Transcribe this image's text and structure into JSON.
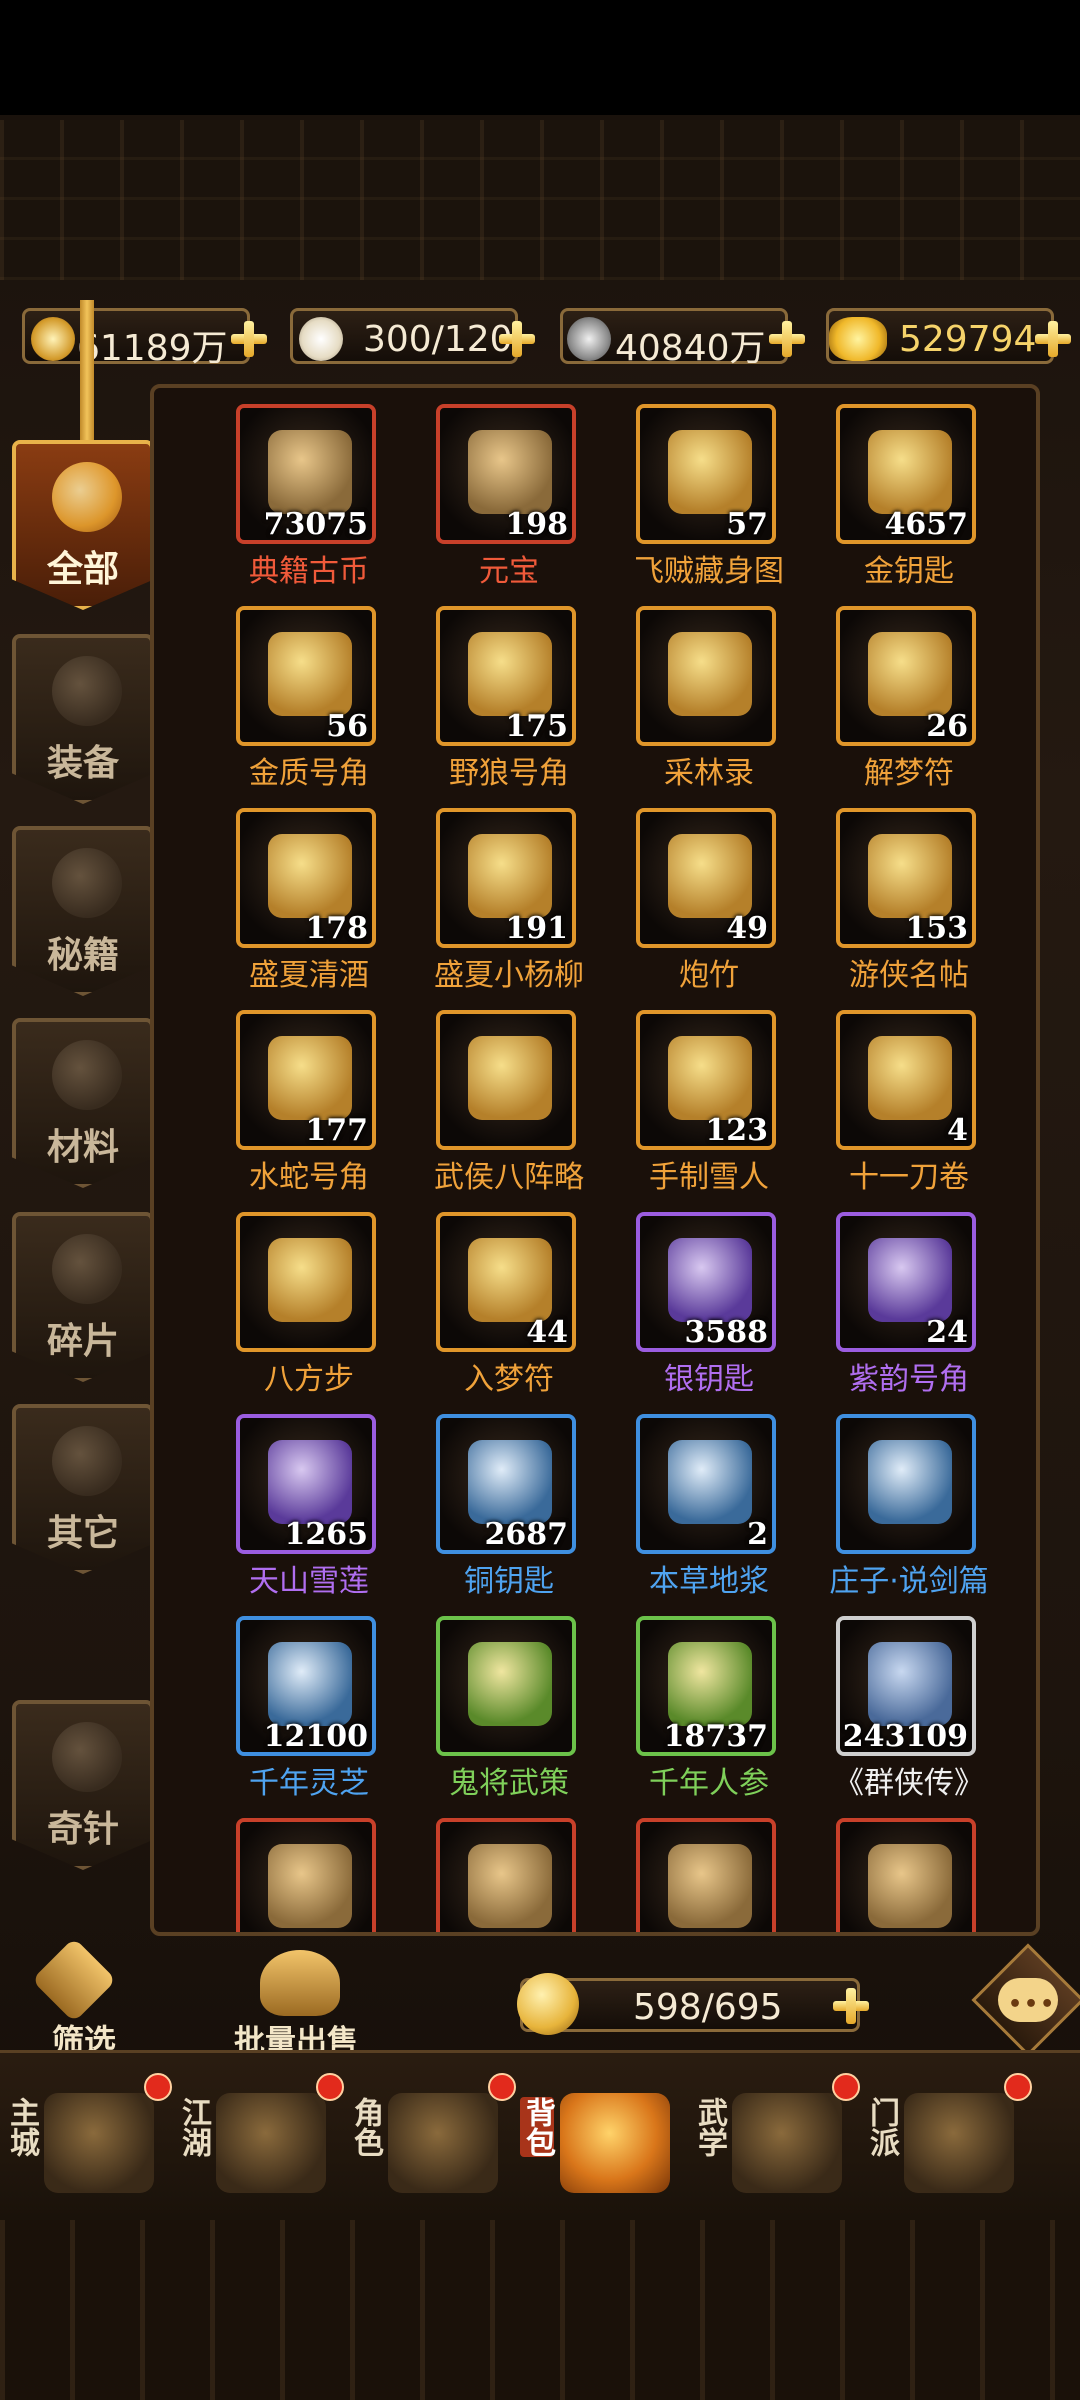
{
  "currencies": [
    {
      "icon": "coin-badge-icon",
      "value": "61189万"
    },
    {
      "icon": "bun-icon",
      "value": "300/120"
    },
    {
      "icon": "silver-coin-icon",
      "value": "40840万"
    },
    {
      "icon": "gold-ingot-icon",
      "value": "529794"
    }
  ],
  "categories": [
    {
      "label": "全部",
      "icon": "money-bag-icon",
      "active": true
    },
    {
      "label": "装备",
      "icon": "sword-icon",
      "active": false
    },
    {
      "label": "秘籍",
      "icon": "scroll-icon",
      "active": false
    },
    {
      "label": "材料",
      "icon": "ore-icon",
      "active": false
    },
    {
      "label": "碎片",
      "icon": "shard-icon",
      "active": false
    },
    {
      "label": "其它",
      "icon": "gourd-icon",
      "active": false
    },
    {
      "label": "奇针",
      "icon": "needle-icon",
      "active": false
    }
  ],
  "items": [
    {
      "name": "典籍古币",
      "count": "73075",
      "rarity": "red"
    },
    {
      "name": "元宝",
      "count": "198",
      "rarity": "red"
    },
    {
      "name": "飞贼藏身图",
      "count": "57",
      "rarity": "orange"
    },
    {
      "name": "金钥匙",
      "count": "4657",
      "rarity": "orange"
    },
    {
      "name": "金质号角",
      "count": "56",
      "rarity": "orange"
    },
    {
      "name": "野狼号角",
      "count": "175",
      "rarity": "orange"
    },
    {
      "name": "采林录",
      "count": "",
      "rarity": "orange"
    },
    {
      "name": "解梦符",
      "count": "26",
      "rarity": "orange"
    },
    {
      "name": "盛夏清酒",
      "count": "178",
      "rarity": "orange"
    },
    {
      "name": "盛夏小杨柳",
      "count": "191",
      "rarity": "orange"
    },
    {
      "name": "炮竹",
      "count": "49",
      "rarity": "orange"
    },
    {
      "name": "游侠名帖",
      "count": "153",
      "rarity": "orange"
    },
    {
      "name": "水蛇号角",
      "count": "177",
      "rarity": "orange"
    },
    {
      "name": "武侯八阵略",
      "count": "",
      "rarity": "orange"
    },
    {
      "name": "手制雪人",
      "count": "123",
      "rarity": "orange"
    },
    {
      "name": "十一刀卷",
      "count": "4",
      "rarity": "orange"
    },
    {
      "name": "八方步",
      "count": "",
      "rarity": "orange"
    },
    {
      "name": "入梦符",
      "count": "44",
      "rarity": "orange"
    },
    {
      "name": "银钥匙",
      "count": "3588",
      "rarity": "purple"
    },
    {
      "name": "紫韵号角",
      "count": "24",
      "rarity": "purple"
    },
    {
      "name": "天山雪莲",
      "count": "1265",
      "rarity": "purple"
    },
    {
      "name": "铜钥匙",
      "count": "2687",
      "rarity": "blue"
    },
    {
      "name": "本草地浆",
      "count": "2",
      "rarity": "blue"
    },
    {
      "name": "庄子·说剑篇",
      "count": "",
      "rarity": "blue"
    },
    {
      "name": "千年灵芝",
      "count": "12100",
      "rarity": "blue"
    },
    {
      "name": "鬼将武策",
      "count": "",
      "rarity": "green"
    },
    {
      "name": "千年人参",
      "count": "18737",
      "rarity": "green"
    },
    {
      "name": "《群侠传》",
      "count": "243109",
      "rarity": "white"
    },
    {
      "name": "",
      "count": "",
      "rarity": "red"
    },
    {
      "name": "",
      "count": "",
      "rarity": "red"
    },
    {
      "name": "",
      "count": "",
      "rarity": "red"
    },
    {
      "name": "",
      "count": "",
      "rarity": "red"
    }
  ],
  "actions": {
    "filter_label": "筛选",
    "bulk_sell_label": "批量出售",
    "capacity": "598/695"
  },
  "nav": [
    {
      "label": "主城",
      "active": false
    },
    {
      "label": "江湖",
      "active": false
    },
    {
      "label": "角色",
      "active": false
    },
    {
      "label": "背包",
      "active": true
    },
    {
      "label": "武学",
      "active": false
    },
    {
      "label": "门派",
      "active": false
    }
  ],
  "colors": {
    "red": "#c8402a",
    "orange": "#e0962a",
    "purple": "#9b5de0",
    "blue": "#3f8fe0",
    "green": "#6cc24a",
    "white": "#cfcfcf",
    "accent_gold": "#e8b24a"
  }
}
